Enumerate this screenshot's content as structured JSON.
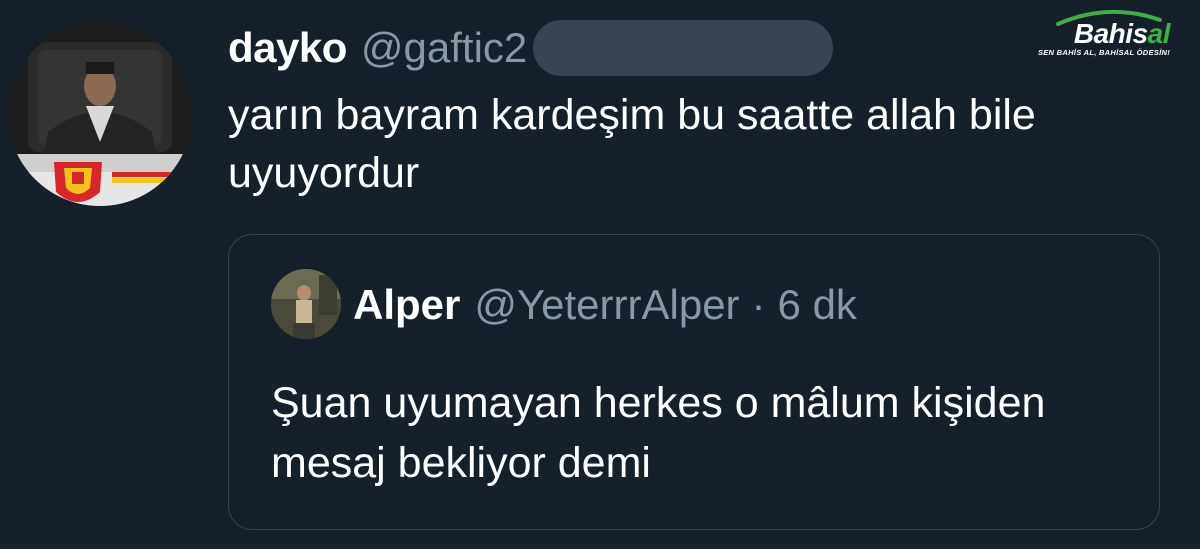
{
  "tweet": {
    "display_name": "dayko",
    "handle": "@gaftic2",
    "text": "yarın bayram kardeşim bu saatte allah bile uyuyordur"
  },
  "quoted_tweet": {
    "display_name": "Alper",
    "handle": "@YeterrrAlper",
    "separator": "·",
    "time": "6 dk",
    "text": "Şuan uyumayan herkes o mâlum kişiden mesaj bekliyor demi"
  },
  "watermark": {
    "brand_main": "Bahis",
    "brand_accent": "al",
    "tagline": "SEN BAHİS AL, BAHİSAL ÖDESİN!"
  },
  "colors": {
    "background": "#15202b",
    "secondary_text": "#8899a6",
    "border": "#38444d",
    "brand_green": "#3fae49"
  }
}
